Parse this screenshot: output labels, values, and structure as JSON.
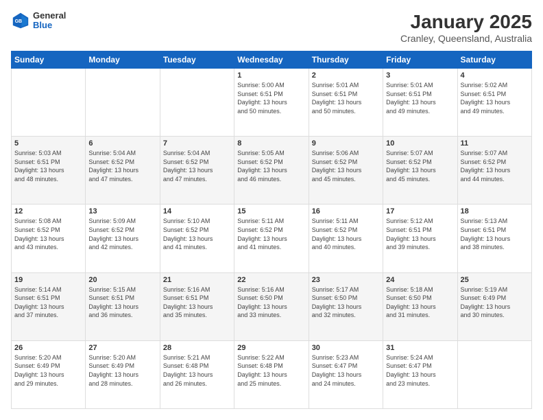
{
  "header": {
    "logo_general": "General",
    "logo_blue": "Blue",
    "month_title": "January 2025",
    "location": "Cranley, Queensland, Australia"
  },
  "days_of_week": [
    "Sunday",
    "Monday",
    "Tuesday",
    "Wednesday",
    "Thursday",
    "Friday",
    "Saturday"
  ],
  "weeks": [
    {
      "row_class": "",
      "days": [
        {
          "date": "",
          "info": ""
        },
        {
          "date": "",
          "info": ""
        },
        {
          "date": "",
          "info": ""
        },
        {
          "date": "1",
          "info": "Sunrise: 5:00 AM\nSunset: 6:51 PM\nDaylight: 13 hours\nand 50 minutes."
        },
        {
          "date": "2",
          "info": "Sunrise: 5:01 AM\nSunset: 6:51 PM\nDaylight: 13 hours\nand 50 minutes."
        },
        {
          "date": "3",
          "info": "Sunrise: 5:01 AM\nSunset: 6:51 PM\nDaylight: 13 hours\nand 49 minutes."
        },
        {
          "date": "4",
          "info": "Sunrise: 5:02 AM\nSunset: 6:51 PM\nDaylight: 13 hours\nand 49 minutes."
        }
      ]
    },
    {
      "row_class": "row-alt",
      "days": [
        {
          "date": "5",
          "info": "Sunrise: 5:03 AM\nSunset: 6:51 PM\nDaylight: 13 hours\nand 48 minutes."
        },
        {
          "date": "6",
          "info": "Sunrise: 5:04 AM\nSunset: 6:52 PM\nDaylight: 13 hours\nand 47 minutes."
        },
        {
          "date": "7",
          "info": "Sunrise: 5:04 AM\nSunset: 6:52 PM\nDaylight: 13 hours\nand 47 minutes."
        },
        {
          "date": "8",
          "info": "Sunrise: 5:05 AM\nSunset: 6:52 PM\nDaylight: 13 hours\nand 46 minutes."
        },
        {
          "date": "9",
          "info": "Sunrise: 5:06 AM\nSunset: 6:52 PM\nDaylight: 13 hours\nand 45 minutes."
        },
        {
          "date": "10",
          "info": "Sunrise: 5:07 AM\nSunset: 6:52 PM\nDaylight: 13 hours\nand 45 minutes."
        },
        {
          "date": "11",
          "info": "Sunrise: 5:07 AM\nSunset: 6:52 PM\nDaylight: 13 hours\nand 44 minutes."
        }
      ]
    },
    {
      "row_class": "",
      "days": [
        {
          "date": "12",
          "info": "Sunrise: 5:08 AM\nSunset: 6:52 PM\nDaylight: 13 hours\nand 43 minutes."
        },
        {
          "date": "13",
          "info": "Sunrise: 5:09 AM\nSunset: 6:52 PM\nDaylight: 13 hours\nand 42 minutes."
        },
        {
          "date": "14",
          "info": "Sunrise: 5:10 AM\nSunset: 6:52 PM\nDaylight: 13 hours\nand 41 minutes."
        },
        {
          "date": "15",
          "info": "Sunrise: 5:11 AM\nSunset: 6:52 PM\nDaylight: 13 hours\nand 41 minutes."
        },
        {
          "date": "16",
          "info": "Sunrise: 5:11 AM\nSunset: 6:52 PM\nDaylight: 13 hours\nand 40 minutes."
        },
        {
          "date": "17",
          "info": "Sunrise: 5:12 AM\nSunset: 6:51 PM\nDaylight: 13 hours\nand 39 minutes."
        },
        {
          "date": "18",
          "info": "Sunrise: 5:13 AM\nSunset: 6:51 PM\nDaylight: 13 hours\nand 38 minutes."
        }
      ]
    },
    {
      "row_class": "row-alt",
      "days": [
        {
          "date": "19",
          "info": "Sunrise: 5:14 AM\nSunset: 6:51 PM\nDaylight: 13 hours\nand 37 minutes."
        },
        {
          "date": "20",
          "info": "Sunrise: 5:15 AM\nSunset: 6:51 PM\nDaylight: 13 hours\nand 36 minutes."
        },
        {
          "date": "21",
          "info": "Sunrise: 5:16 AM\nSunset: 6:51 PM\nDaylight: 13 hours\nand 35 minutes."
        },
        {
          "date": "22",
          "info": "Sunrise: 5:16 AM\nSunset: 6:50 PM\nDaylight: 13 hours\nand 33 minutes."
        },
        {
          "date": "23",
          "info": "Sunrise: 5:17 AM\nSunset: 6:50 PM\nDaylight: 13 hours\nand 32 minutes."
        },
        {
          "date": "24",
          "info": "Sunrise: 5:18 AM\nSunset: 6:50 PM\nDaylight: 13 hours\nand 31 minutes."
        },
        {
          "date": "25",
          "info": "Sunrise: 5:19 AM\nSunset: 6:49 PM\nDaylight: 13 hours\nand 30 minutes."
        }
      ]
    },
    {
      "row_class": "",
      "days": [
        {
          "date": "26",
          "info": "Sunrise: 5:20 AM\nSunset: 6:49 PM\nDaylight: 13 hours\nand 29 minutes."
        },
        {
          "date": "27",
          "info": "Sunrise: 5:20 AM\nSunset: 6:49 PM\nDaylight: 13 hours\nand 28 minutes."
        },
        {
          "date": "28",
          "info": "Sunrise: 5:21 AM\nSunset: 6:48 PM\nDaylight: 13 hours\nand 26 minutes."
        },
        {
          "date": "29",
          "info": "Sunrise: 5:22 AM\nSunset: 6:48 PM\nDaylight: 13 hours\nand 25 minutes."
        },
        {
          "date": "30",
          "info": "Sunrise: 5:23 AM\nSunset: 6:47 PM\nDaylight: 13 hours\nand 24 minutes."
        },
        {
          "date": "31",
          "info": "Sunrise: 5:24 AM\nSunset: 6:47 PM\nDaylight: 13 hours\nand 23 minutes."
        },
        {
          "date": "",
          "info": ""
        }
      ]
    }
  ]
}
